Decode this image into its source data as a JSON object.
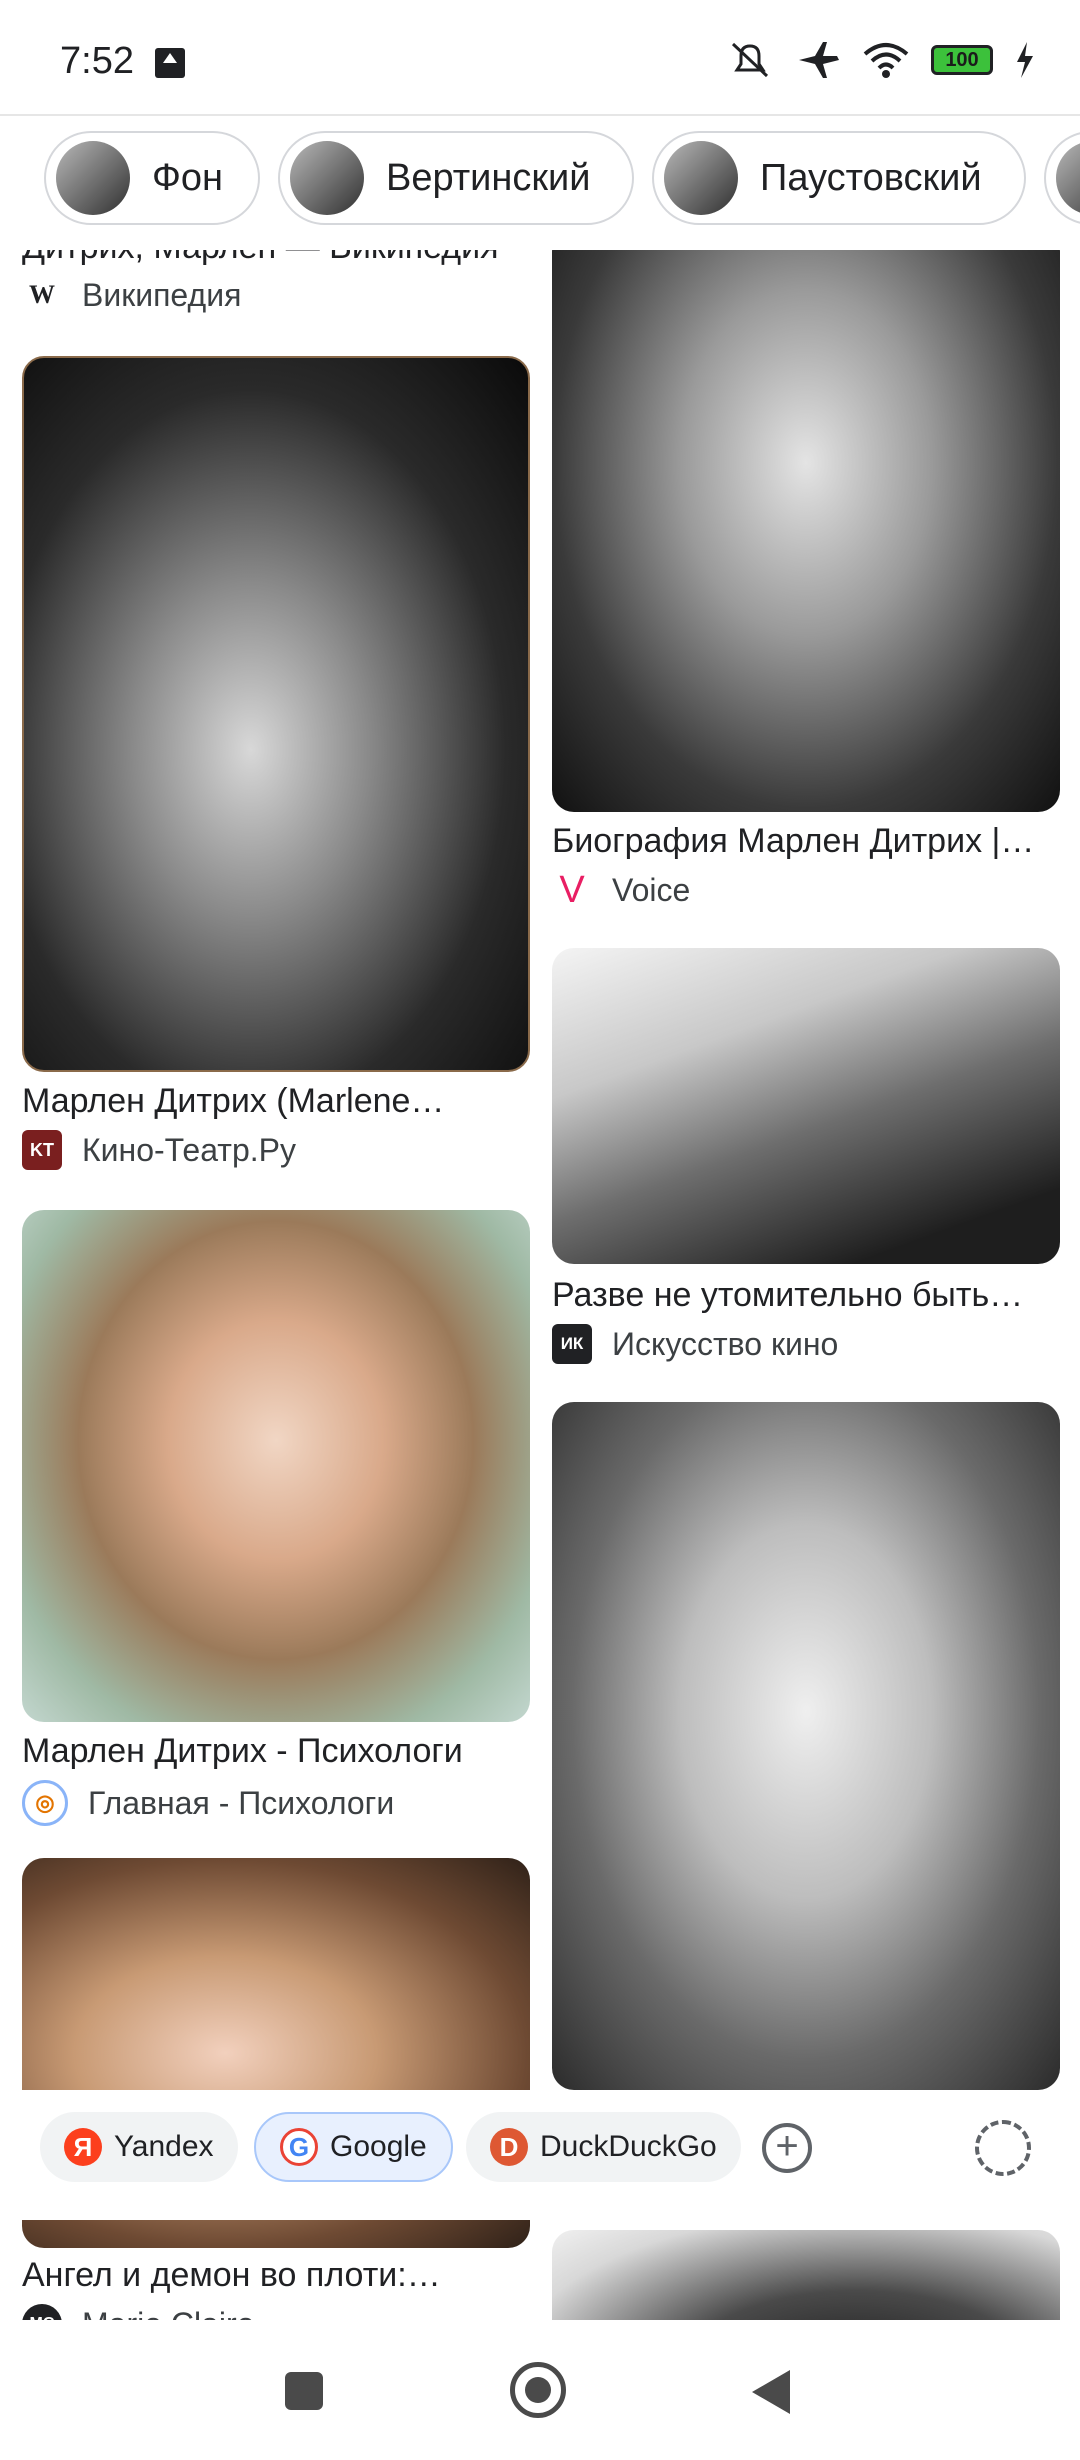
{
  "status_bar": {
    "time": "7:52",
    "battery": "100",
    "icons": [
      "upload-icon",
      "mute-icon",
      "airplane-icon",
      "wifi-icon",
      "battery-icon",
      "charging-icon"
    ]
  },
  "chips": [
    {
      "label": "Фон"
    },
    {
      "label": "Вертинский"
    },
    {
      "label": "Паустовский"
    }
  ],
  "results": {
    "left": [
      {
        "title": "Дитрих, Марлен — Википедия",
        "source": "Википедия",
        "source_icon": "W"
      },
      {
        "title": "Марлен Дитрих (Marlene…",
        "source": "Кино-Театр.Ру",
        "source_icon": "KT"
      },
      {
        "title": "Марлен Дитрих - Психологи",
        "source": "Главная - Психологи",
        "source_icon": "◎"
      },
      {
        "title": "Ангел и демон во плоти:…",
        "source": "Marie Claire",
        "source_icon": "MC"
      }
    ],
    "right": [
      {
        "title": "Биография Марлен Дитрих |…",
        "source": "Voice",
        "source_icon": "V"
      },
      {
        "title": "Разве не утомительно быть…",
        "source": "Искусство кино",
        "source_icon": "ИК"
      },
      {
        "title": "",
        "source": "",
        "source_icon": ""
      },
      {
        "title": "",
        "source": "",
        "source_icon": ""
      }
    ]
  },
  "engines": [
    {
      "label": "Yandex",
      "logo": "Я",
      "color": "#fc3f1d"
    },
    {
      "label": "Google",
      "logo": "G",
      "color": "#4285f4"
    },
    {
      "label": "DuckDuckGo",
      "logo": "D",
      "color": "#de5833"
    }
  ],
  "engine_bar": {
    "add": "+"
  },
  "colors": {
    "accent": "#1a73e8",
    "chip_border": "#d5d7db"
  }
}
